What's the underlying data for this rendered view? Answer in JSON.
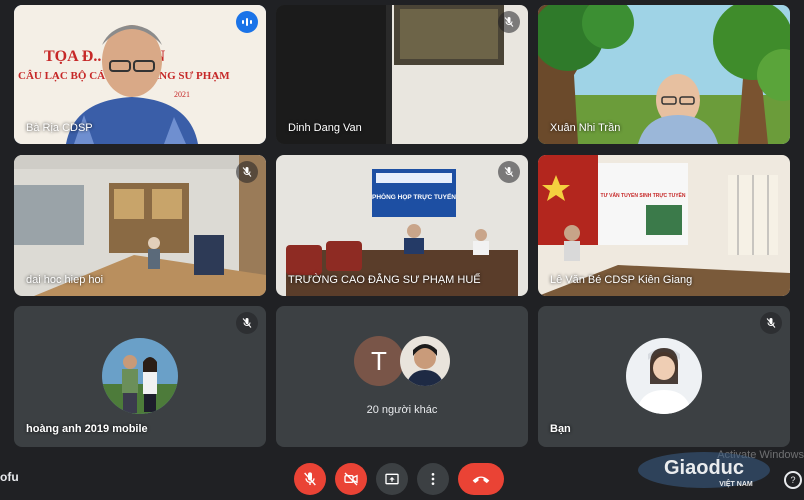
{
  "tiles": [
    {
      "name": "Bà Rịa CDSP",
      "banner_line1": "TỌA Đ... TUYẾN",
      "banner_line2": "CÂU LẠC BỘ CÁ... CAO ĐẲNG SƯ PHẠM",
      "banner_year": "2021"
    },
    {
      "name": "Dinh Dang Van"
    },
    {
      "name": "Xuân Nhi Trần"
    },
    {
      "name": "dai hoc hiep hoi"
    },
    {
      "name": "TRƯỜNG CAO ĐẲNG SƯ PHẠM HUẾ",
      "screen_text": "PHÒNG HỌP TRỰC TUYẾN"
    },
    {
      "name": "Lê Văn Bé CDSP Kiên Giang",
      "board_text": "TƯ VẤN TUYỂN SINH TRỰC TUYẾN"
    },
    {
      "name": "hoàng anh 2019 mobile"
    },
    {
      "name": "20 người khác",
      "initial": "T"
    },
    {
      "name": "Bạn"
    }
  ],
  "bottom": {
    "meeting_code": "ofu"
  },
  "controls": {
    "mic": "mic-off-icon",
    "camera": "camera-off-icon",
    "present": "present-screen-icon",
    "more": "more-vert-icon",
    "leave": "call-end-icon"
  },
  "watermark": {
    "brand": "Giaoduc",
    "sub": "VIỆT NAM",
    "overlay": "Activate Windows"
  },
  "colors": {
    "accent": "#8ab4f8",
    "danger": "#ea4335",
    "tile": "#3c4043",
    "bg": "#202124"
  }
}
